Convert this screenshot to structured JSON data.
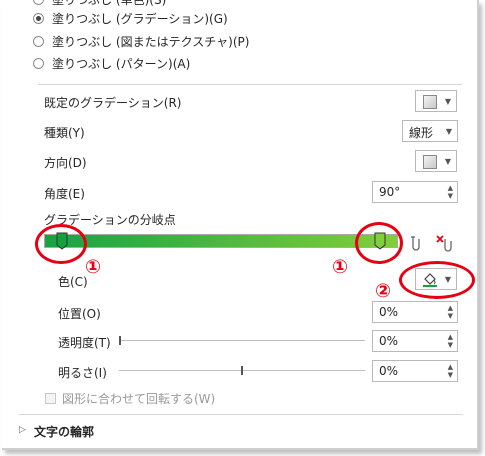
{
  "fill_options": {
    "top_partial": "塗りつぶし (単色)(S)",
    "gradient": "塗りつぶし (グラデーション)(G)",
    "picture": "塗りつぶし (図またはテクスチャ)(P)",
    "pattern": "塗りつぶし (パターン)(A)"
  },
  "preset": {
    "label": "既定のグラデーション(R)"
  },
  "type": {
    "label": "種類(Y)",
    "value": "線形"
  },
  "direction": {
    "label": "方向(D)"
  },
  "angle": {
    "label": "角度(E)",
    "value": "90°"
  },
  "gradient_stops": {
    "label": "グラデーションの分岐点"
  },
  "color": {
    "label": "色(C)"
  },
  "position": {
    "label": "位置(O)",
    "value": "0%"
  },
  "transparency": {
    "label": "透明度(T)",
    "value": "0%",
    "level": 0
  },
  "brightness": {
    "label": "明るさ(I)",
    "value": "0%",
    "level": 0.5
  },
  "rotate": {
    "label": "図形に合わせて回転する(W)"
  },
  "text_outline": {
    "label": "文字の輪郭"
  },
  "annotations": {
    "one": "①",
    "two": "②"
  },
  "colors": {
    "gradient_start": "#19a241",
    "gradient_end": "#7fcf3c",
    "annotation": "#e60012",
    "fill_color": "#13a03d"
  },
  "icons": {
    "preset_swatch": "gradient-swatch-icon",
    "direction_swatch": "direction-swatch-icon",
    "add_stop": "add-stop-icon",
    "remove_stop": "remove-stop-icon",
    "paint_bucket": "paint-bucket-icon",
    "expand": "triangle-right-icon"
  }
}
